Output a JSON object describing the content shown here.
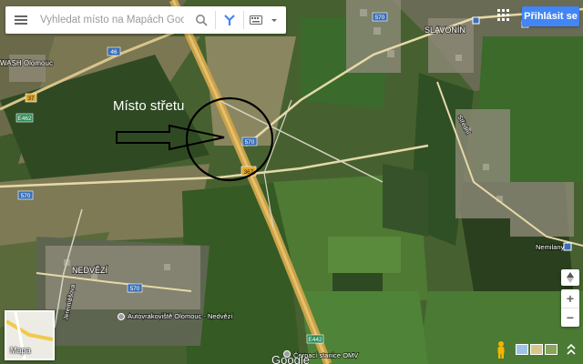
{
  "search": {
    "placeholder": "Vyhledat místo na Mapách Google"
  },
  "account": {
    "signin_label": "Přihlásit se"
  },
  "annotation": {
    "text": "Místo střetu"
  },
  "map": {
    "brand": "Google",
    "places": [
      {
        "text": "WASH Olomouc"
      },
      {
        "text": "SLAVONÍN"
      },
      {
        "text": "NEDVĚZÍ"
      },
      {
        "text": "Autovrakoviště Olomouc - Nedvězí"
      },
      {
        "text": "Čerpací stanice OMV"
      },
      {
        "text": "Nemilany"
      }
    ],
    "streets": [
      {
        "text": "Jeremiášova"
      },
      {
        "text": "Střední"
      }
    ],
    "route_shields": [
      {
        "text": "46"
      },
      {
        "text": "570"
      },
      {
        "text": "570"
      },
      {
        "text": "367"
      },
      {
        "text": "570"
      },
      {
        "text": "570"
      },
      {
        "text": "E442"
      },
      {
        "text": "E462"
      },
      {
        "text": "37"
      }
    ]
  },
  "minimap": {
    "label": "Mapa"
  },
  "colors": {
    "accent": "#4285f4",
    "annotation": "#000000"
  }
}
